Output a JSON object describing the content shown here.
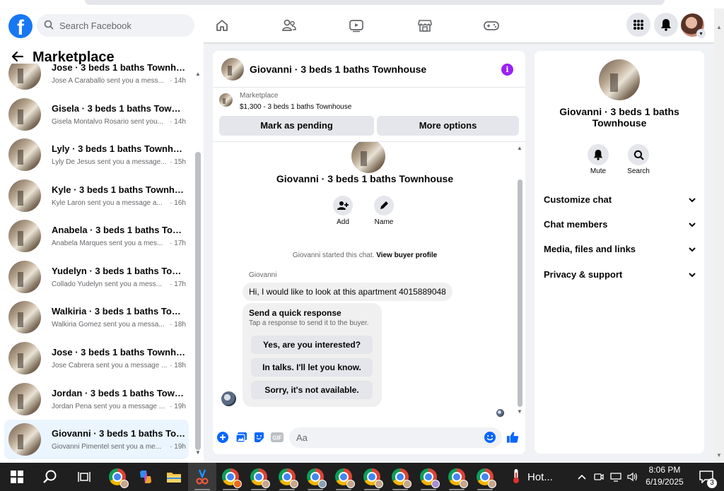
{
  "topbar": {
    "logo_letter": "f",
    "search_placeholder": "Search Facebook",
    "nav_icons": [
      "home-icon",
      "friends-icon",
      "video-icon",
      "marketplace-icon",
      "gaming-icon"
    ],
    "right_icons": [
      "menu-grid-icon",
      "bell-icon",
      "profile-avatar"
    ]
  },
  "sidebar": {
    "title": "Marketplace",
    "items": [
      {
        "title": "Jose · 3 beds 1 baths Townhouse",
        "message": "Jose A Caraballo sent you a mess...",
        "time": "· 14h"
      },
      {
        "title": "Gisela · 3 beds 1 baths Townhou...",
        "message": "Gisela Montalvo Rosario sent you...",
        "time": "· 14h"
      },
      {
        "title": "Lyly · 3 beds 1 baths Townhouse",
        "message": "Lyly De Jesus sent you a message...",
        "time": "· 15h"
      },
      {
        "title": "Kyle · 3 beds 1 baths Townhouse",
        "message": "Kyle Laron sent you a message a...",
        "time": "· 16h"
      },
      {
        "title": "Anabela · 3 beds 1 baths Townh...",
        "message": "Anabela Marques sent you a mes...",
        "time": "· 17h"
      },
      {
        "title": "Yudelyn · 3 beds 1 baths Townh...",
        "message": "Collado Yudelyn sent you a mess...",
        "time": "· 17h"
      },
      {
        "title": "Walkiria · 3 beds 1 baths Townh...",
        "message": "Walkiria Gomez sent you a messa...",
        "time": "· 18h"
      },
      {
        "title": "Jose · 3 beds 1 baths Townhouse",
        "message": "Jose Cabrera sent you a message ...",
        "time": "· 18h"
      },
      {
        "title": "Jordan · 3 beds 1 baths Townho...",
        "message": "Jordan Pena sent you a message ...",
        "time": "· 19h"
      },
      {
        "title": "Giovanni · 3 beds 1 baths Townh...",
        "message": "Giovanni Pimentel sent you a me...",
        "time": "· 19h",
        "selected": true
      }
    ]
  },
  "chat": {
    "title": "Giovanni · 3 beds 1 baths Townhouse",
    "marketplace_label": "Marketplace",
    "listing": "$1,300 - 3 beds 1 baths Townhouse",
    "mark_pending": "Mark as pending",
    "more_options": "More options",
    "body_name": "Giovanni · 3 beds 1 baths Townhouse",
    "add_label": "Add",
    "name_label": "Name",
    "started_text": "Giovanni started this chat.",
    "view_profile": "View buyer profile",
    "sender": "Giovanni",
    "message": "Hi, I would like to look at this apartment 4015889048",
    "quick_title": "Send a quick response",
    "quick_sub": "Tap a response to send it to the buyer.",
    "quick_replies": [
      "Yes, are you interested?",
      "In talks. I'll let you know.",
      "Sorry, it's not available."
    ],
    "composer_placeholder": "Aa"
  },
  "right_panel": {
    "name": "Giovanni · 3 beds 1 baths Townhouse",
    "mute": "Mute",
    "search": "Search",
    "sections": [
      "Customize chat",
      "Chat members",
      "Media, files and links",
      "Privacy & support"
    ]
  },
  "taskbar": {
    "weather": "Hot...",
    "time": "8:06 PM",
    "date": "6/19/2025",
    "notification_count": "3"
  },
  "colors": {
    "brand": "#1877f2",
    "info": "#9b21f3",
    "selected": "#ebf5ff"
  }
}
